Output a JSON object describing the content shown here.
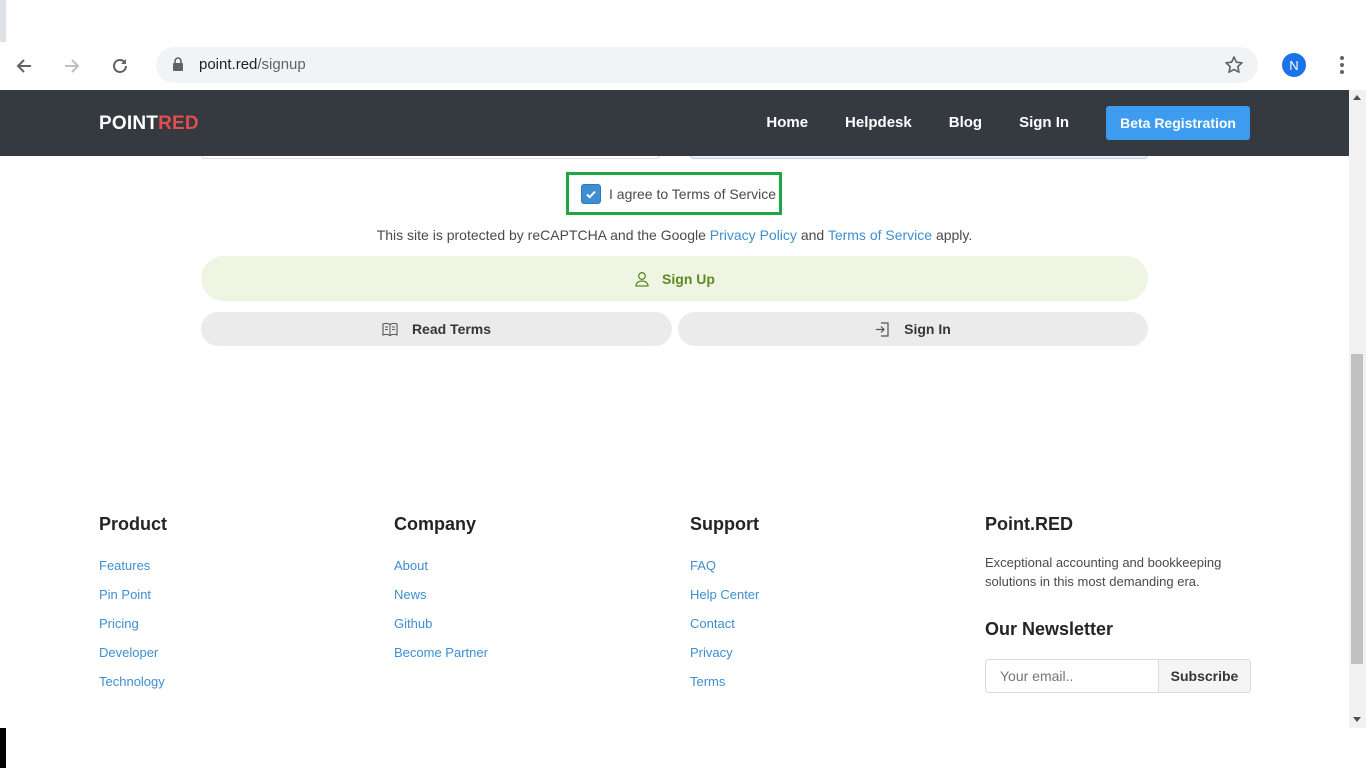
{
  "browser": {
    "url_host": "point.red",
    "url_path": "/signup",
    "profile_initial": "N",
    "profile_color": "#1a73e8"
  },
  "navbar": {
    "brand_part1": "POINT",
    "brand_part2": "RED",
    "brand_accent": "#e04e4e",
    "links": [
      "Home",
      "Helpdesk",
      "Blog",
      "Sign In"
    ],
    "cta": "Beta Registration",
    "cta_color": "#3e9cf0"
  },
  "form": {
    "agree_label": "I agree to Terms of Service",
    "agree_checked": true,
    "recaptcha_prefix": "This site is protected by reCAPTCHA and the Google",
    "recaptcha_privacy": "Privacy Policy",
    "recaptcha_and": "and",
    "recaptcha_terms": "Terms of Service",
    "recaptcha_suffix": "apply.",
    "signup_label": "Sign Up",
    "read_terms_label": "Read Terms",
    "signin_label": "Sign In",
    "highlight_color": "#20a644"
  },
  "footer": {
    "product": {
      "title": "Product",
      "links": [
        "Features",
        "Pin Point",
        "Pricing",
        "Developer",
        "Technology"
      ]
    },
    "company": {
      "title": "Company",
      "links": [
        "About",
        "News",
        "Github",
        "Become Partner"
      ]
    },
    "support": {
      "title": "Support",
      "links": [
        "FAQ",
        "Help Center",
        "Contact",
        "Privacy",
        "Terms"
      ]
    },
    "about": {
      "title": "Point.RED",
      "text": "Exceptional accounting and bookkeeping solutions in this most demanding era.",
      "newsletter_title": "Our Newsletter",
      "email_placeholder": "Your email..",
      "subscribe_label": "Subscribe"
    }
  }
}
